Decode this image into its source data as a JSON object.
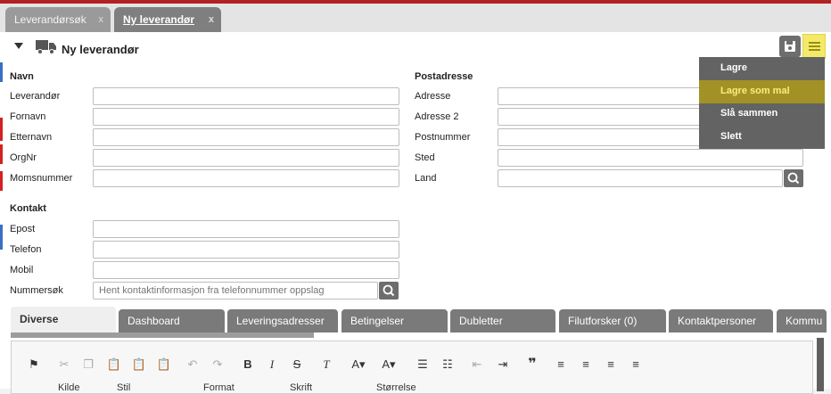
{
  "tabs": [
    {
      "label": "Leverandørsøk",
      "close": "x"
    },
    {
      "label": "Ny leverandør",
      "close": "x"
    }
  ],
  "header": {
    "title": "Ny leverandør"
  },
  "menu": {
    "items": [
      "Lagre",
      "Lagre som mal",
      "Slå sammen",
      "Slett"
    ],
    "highlighted": "Lagre som mal"
  },
  "navn": {
    "title": "Navn",
    "fields": [
      {
        "label": "Leverandør",
        "value": ""
      },
      {
        "label": "Fornavn",
        "value": ""
      },
      {
        "label": "Etternavn",
        "value": ""
      },
      {
        "label": "OrgNr",
        "value": ""
      },
      {
        "label": "Momsnummer",
        "value": ""
      }
    ]
  },
  "kontakt": {
    "title": "Kontakt",
    "fields": [
      {
        "label": "Epost",
        "value": ""
      },
      {
        "label": "Telefon",
        "value": ""
      },
      {
        "label": "Mobil",
        "value": ""
      },
      {
        "label": "Nummersøk",
        "placeholder": "Hent kontaktinformasjon fra telefonnummer oppslag"
      }
    ]
  },
  "postadresse": {
    "title": "Postadresse",
    "fields": [
      {
        "label": "Adresse",
        "value": ""
      },
      {
        "label": "Adresse 2",
        "value": ""
      },
      {
        "label": "Postnummer",
        "value": ""
      },
      {
        "label": "Sted",
        "value": ""
      },
      {
        "label": "Land",
        "value": ""
      }
    ]
  },
  "subtabs": [
    "Diverse",
    "Dashboard",
    "Leveringsadresser",
    "Betingelser",
    "Dubletter",
    "Filutforsker (0)",
    "Kontaktpersoner",
    "Kommu"
  ],
  "editor": {
    "row2": [
      "Kilde",
      "Stil",
      "Format",
      "Skrift",
      "Størrelse"
    ]
  },
  "colors": {
    "accent": "#f3ea6a",
    "menu_bg": "#636363",
    "menu_highlight": "#a29226",
    "tab_bg": "#7a7a7a"
  }
}
